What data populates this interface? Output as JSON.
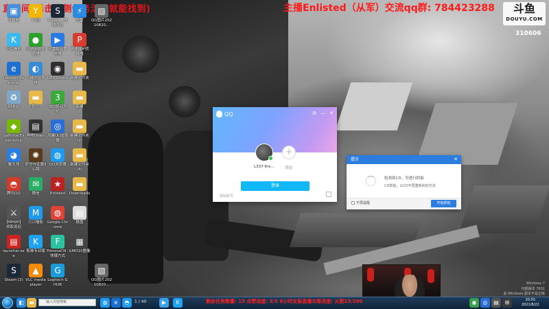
{
  "stream_overlay": {
    "left_text": "直播间(单击右侧任务活动就能找到)",
    "center_text": "主播Enlisted（从军）交流qq群: 784423288",
    "logo_big": "斗鱼",
    "logo_small": "DOUYU.COM",
    "room_id": "310606"
  },
  "desktop_icons": [
    {
      "label": "计算机",
      "glyph": "▣",
      "color": "#4a90d9"
    },
    {
      "label": "YY迎",
      "glyph": "Y",
      "color": "#f2b705"
    },
    {
      "label": "Steam - 快捷方式",
      "glyph": "S",
      "color": "#1b2838"
    },
    {
      "label": "迅雷",
      "glyph": "⚡",
      "color": "#2b8ae2"
    },
    {
      "label": "QQ图片20210820...",
      "glyph": "▧",
      "color": "#666"
    },
    {
      "label": "万兴神剪",
      "glyph": "K",
      "color": "#3cb8f0"
    },
    {
      "label": "迅游网游加速器",
      "glyph": "●",
      "color": "#2ea02e"
    },
    {
      "label": "迅雷影音播放器",
      "glyph": "▶",
      "color": "#2a7ae4"
    },
    {
      "label": "极速PDF转换器",
      "glyph": "P",
      "color": "#d63c2f"
    },
    {
      "label": "Internet Explorer",
      "glyph": "e",
      "color": "#1d6fd1"
    },
    {
      "label": "一键还原系统",
      "glyph": "◐",
      "color": "#3a8bd6"
    },
    {
      "label": "OBS Studio",
      "glyph": "◉",
      "color": "#302e31"
    },
    {
      "label": "新建文件夹",
      "glyph": "▬",
      "color": "#e6b94a"
    },
    {
      "label": "回收站",
      "glyph": "♻",
      "color": "#7fa7c9"
    },
    {
      "label": "图片",
      "glyph": "▬",
      "color": "#e6b94a"
    },
    {
      "label": "360驱动大师",
      "glyph": "3",
      "color": "#3aa83a"
    },
    {
      "label": "新建",
      "glyph": "▬",
      "color": "#e6b94a"
    },
    {
      "label": "GeForce Experience",
      "glyph": "◆",
      "color": "#76b900"
    },
    {
      "label": "哔哩Down",
      "glyph": "▤",
      "color": "#333"
    },
    {
      "label": "风暴UU加速器",
      "glyph": "◎",
      "color": "#2b6fd6"
    },
    {
      "label": "新建文件夹(2)",
      "glyph": "▬",
      "color": "#e6b94a"
    },
    {
      "label": "鲁大师",
      "glyph": "◕",
      "color": "#2c7de0"
    },
    {
      "label": "命令与征服3心跳",
      "glyph": "✺",
      "color": "#5a3c1c"
    },
    {
      "label": "QQ浏览器",
      "glyph": "◍",
      "color": "#1e9bf0"
    },
    {
      "label": "新建文件夹(4)",
      "glyph": "▬",
      "color": "#e6b94a"
    },
    {
      "label": "腾讯QQ",
      "glyph": "◓",
      "color": "#d23a2a"
    },
    {
      "label": "微信",
      "glyph": "✉",
      "color": "#2aae67"
    },
    {
      "label": "Enlisted",
      "glyph": "★",
      "color": "#b22"
    },
    {
      "label": "Downloads",
      "glyph": "▬",
      "color": "#e6b94a"
    },
    {
      "label": "【MHWI】抓取连招",
      "glyph": "⚔",
      "color": "#555"
    },
    {
      "label": "万兴喵影",
      "glyph": "M",
      "color": "#1f9be8"
    },
    {
      "label": "Google Chrome",
      "glyph": "◍",
      "color": "#db4437"
    },
    {
      "label": "稳盘",
      "glyph": "▤",
      "color": "#ddd"
    },
    {
      "label": "launcher.exe",
      "glyph": "▤",
      "color": "#c22"
    },
    {
      "label": "剪映专业版",
      "glyph": "K",
      "color": "#1fa2f0"
    },
    {
      "label": "FilmoraCN - 快捷方式",
      "glyph": "F",
      "color": "#2ec3a0"
    },
    {
      "label": "GMO10图像",
      "glyph": "▦",
      "color": "#444"
    },
    {
      "label": "Steam (2)",
      "glyph": "S",
      "color": "#1b2838"
    },
    {
      "label": "VLC media player",
      "glyph": "▲",
      "color": "#f28c0f"
    },
    {
      "label": "Logitech G HUB",
      "glyph": "G",
      "color": "#1b9cd8"
    },
    {
      "label": "QQ图片20210820...",
      "glyph": "▧",
      "color": "#666"
    }
  ],
  "qq_window": {
    "title": "QQ",
    "account_name": "L337-Kre...",
    "add_label": "添加",
    "login_button": "登录",
    "remove_account": "移除账号",
    "settings_icon": "gear-icon",
    "min_icon": "minimize-icon",
    "close_icon": "close-icon"
  },
  "prompt_dialog": {
    "title": "提示",
    "message_line1": "检测到CD，可进行抓拍",
    "message_line2": "CD抓拍，以CD不再重新的好方法",
    "checkbox_label": "不再提醒",
    "action_button": "开始抓拍"
  },
  "taskbar": {
    "search_placeholder": "输入内容搜索",
    "page_count": "1 / 40",
    "stream_status": "剩余任务数量: 15   点赞进度: 3/5   8小时女装直播众筹进度: 火箭23/200",
    "tray_time": "20:55",
    "tray_date": "2021/8/22"
  },
  "watermark": {
    "line1": "Windows 7",
    "line2": "内部版本 7601",
    "line3": "此 Windows 副本不是正版"
  }
}
